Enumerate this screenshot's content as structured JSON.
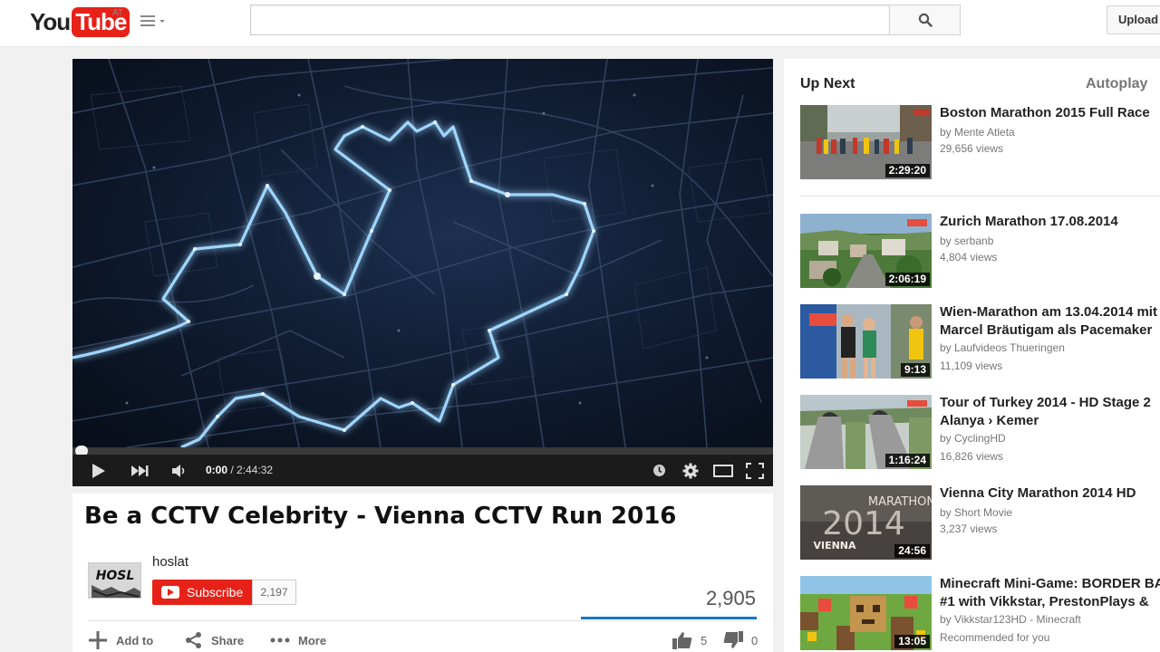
{
  "header": {
    "logo_you": "You",
    "logo_tube": "Tube",
    "country": "AT",
    "search_placeholder": "",
    "upload_label": "Upload"
  },
  "player": {
    "current_time": "0:00",
    "separator": " / ",
    "duration": "2:44:32",
    "progress": 0,
    "colors": {
      "progress": "#cc181e",
      "route_glow": "#9fd6ff"
    }
  },
  "video": {
    "title": "Be a CCTV Celebrity - Vienna CCTV Run 2016",
    "channel_name": "hoslat",
    "channel_logo_text": "HOSL",
    "subscribe_label": "Subscribe",
    "subscriber_count": "2,197",
    "view_count": "2,905",
    "actions": {
      "add_to": "Add to",
      "share": "Share",
      "more": "More"
    },
    "likes": "5",
    "dislikes": "0"
  },
  "sidebar": {
    "heading": "Up Next",
    "autoplay_label": "Autoplay",
    "videos": [
      {
        "title": "Boston Marathon 2015 Full Race",
        "title2": "",
        "channel": "by Mente Atleta",
        "views": "29,656 views",
        "duration": "2:29:20",
        "icon": "marathon-runners-thumbnail"
      },
      {
        "title": "Zurich Marathon 17.08.2014",
        "title2": "",
        "channel": "by serbanb",
        "views": "4,804 views",
        "duration": "2:06:19",
        "icon": "aerial-city-thumbnail"
      },
      {
        "title": "Wien-Marathon am 13.04.2014 mit",
        "title2": "Marcel Bräutigam als Pacemaker",
        "channel": "by Laufvideos Thueringen",
        "views": "11,109 views",
        "duration": "9:13",
        "icon": "runners-thumbnail"
      },
      {
        "title": "Tour of Turkey 2014 - HD Stage 2",
        "title2": "Alanya › Kemer",
        "channel": "by CyclingHD",
        "views": "16,826 views",
        "duration": "1:16:24",
        "icon": "tunnel-road-thumbnail"
      },
      {
        "title": "Vienna City Marathon 2014 HD",
        "title2": "",
        "channel": "by Short Movie",
        "views": "3,237 views",
        "duration": "24:56",
        "icon": "marathon-title-thumbnail",
        "thumb_text": "MARATHON",
        "thumb_year": "2014",
        "thumb_city": "VIENNA"
      },
      {
        "title": "Minecraft Mini-Game: BORDER BATTLE",
        "title2": "#1 with Vikkstar, PrestonPlays &",
        "channel": "by Vikkstar123HD - Minecraft",
        "views": "Recommended for you",
        "duration": "13:05",
        "icon": "minecraft-thumbnail"
      }
    ]
  }
}
